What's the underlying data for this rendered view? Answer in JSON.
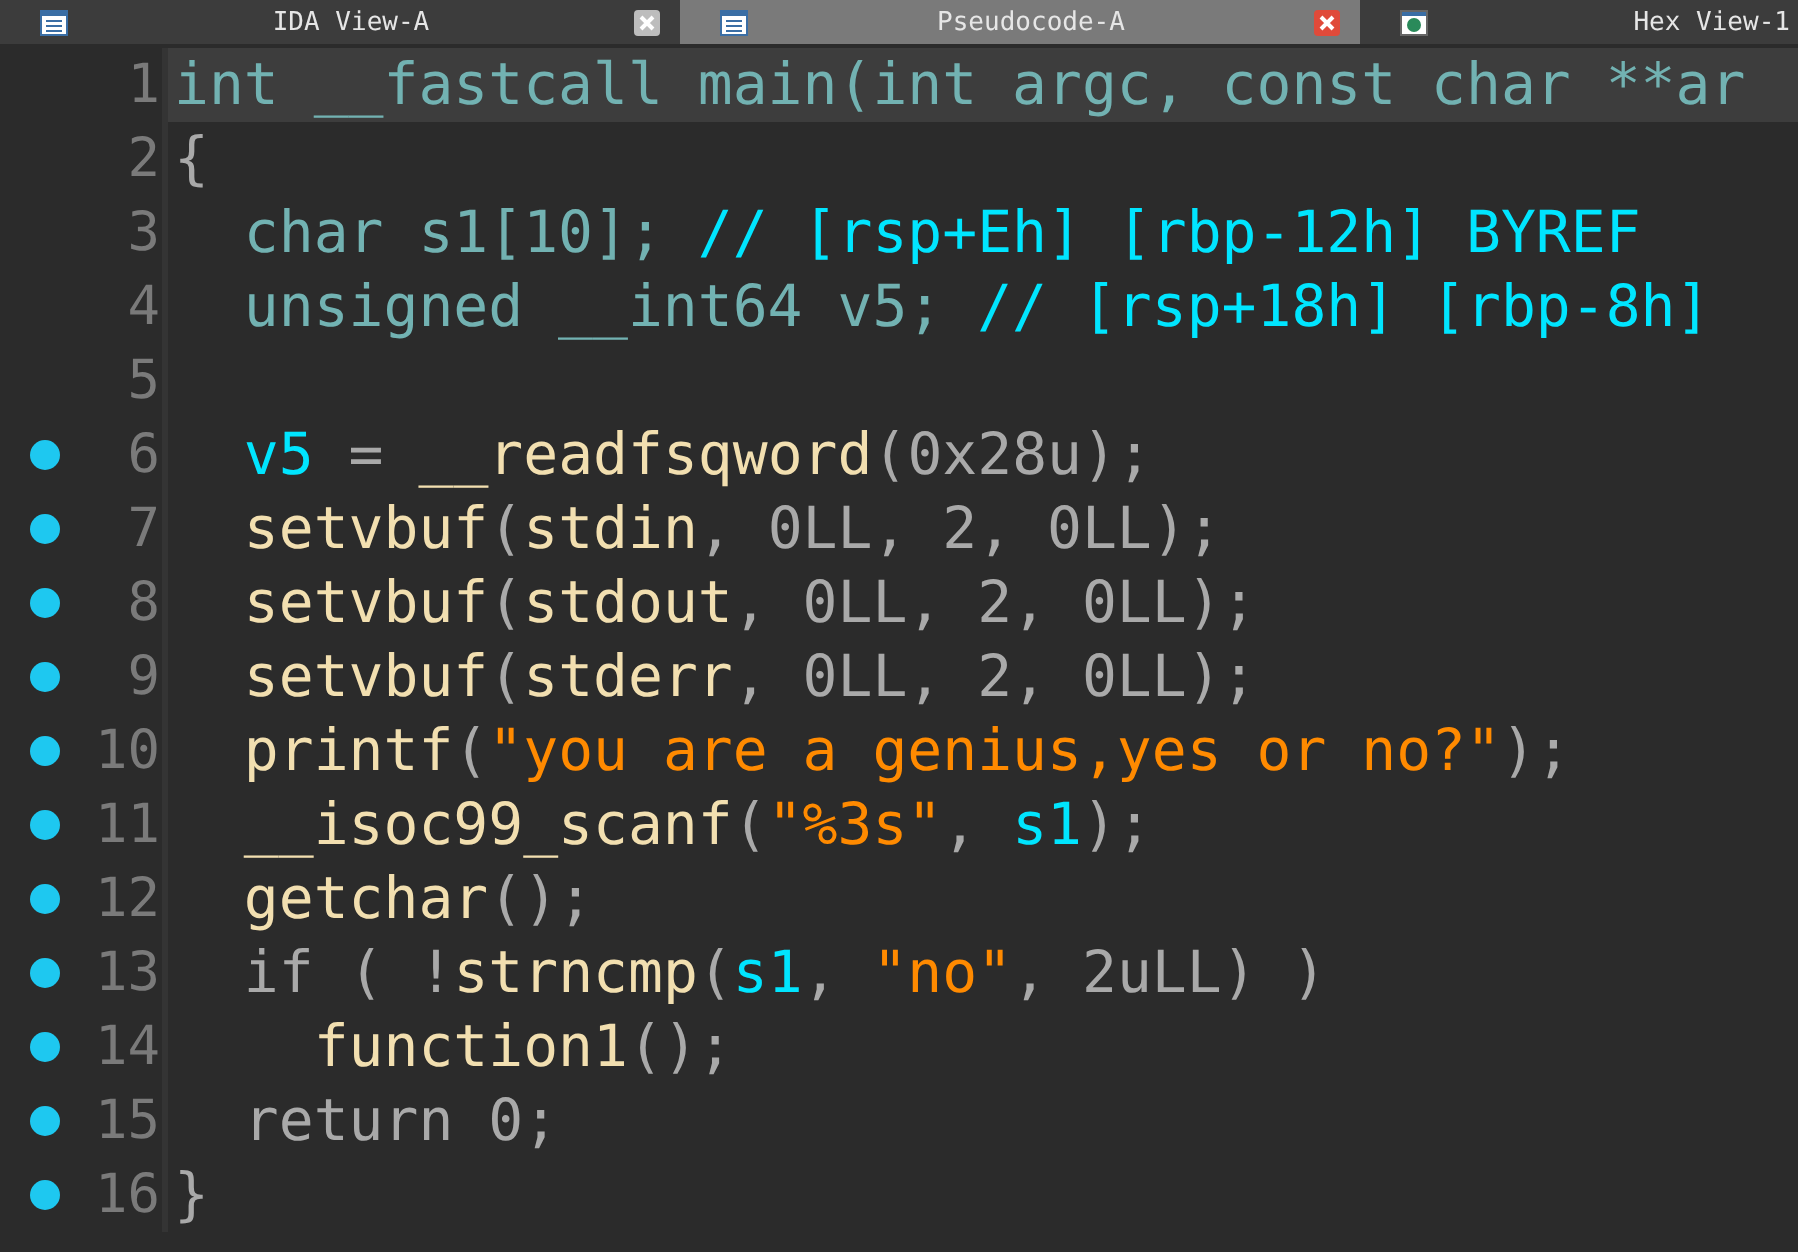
{
  "tabs": [
    {
      "label": "IDA View-A",
      "selected": false,
      "closable": true
    },
    {
      "label": "Pseudocode-A",
      "selected": true,
      "closable": true
    },
    {
      "label": "Hex View-1",
      "selected": false,
      "closable": false
    }
  ],
  "code": {
    "lines": [
      {
        "number": "1",
        "dot": false,
        "current": true,
        "tokens": [
          {
            "text": "int __fastcall main(int argc, const char **ar",
            "kind": "type"
          }
        ]
      },
      {
        "number": "2",
        "dot": false,
        "current": false,
        "tokens": [
          {
            "text": "{",
            "kind": "punct"
          }
        ]
      },
      {
        "number": "3",
        "dot": false,
        "current": false,
        "tokens": [
          {
            "text": "  char s1[10];",
            "kind": "type"
          },
          {
            "text": " // [rsp+Eh] [rbp-12h] BYREF",
            "kind": "comment"
          }
        ]
      },
      {
        "number": "4",
        "dot": false,
        "current": false,
        "tokens": [
          {
            "text": "  unsigned __int64 v5;",
            "kind": "type"
          },
          {
            "text": " // [rsp+18h] [rbp-8h]",
            "kind": "comment"
          }
        ]
      },
      {
        "number": "5",
        "dot": false,
        "current": false
      },
      {
        "number": "6",
        "dot": true,
        "current": false,
        "tokens": [
          {
            "text": "  v5",
            "kind": "var"
          },
          {
            "text": " = ",
            "kind": "punct"
          },
          {
            "text": "__readfsqword",
            "kind": "func"
          },
          {
            "text": "(",
            "kind": "punct"
          },
          {
            "text": "0x28u",
            "kind": "num"
          },
          {
            "text": ");",
            "kind": "punct"
          }
        ]
      },
      {
        "number": "7",
        "dot": true,
        "current": false,
        "tokens": [
          {
            "text": "  setvbuf",
            "kind": "func"
          },
          {
            "text": "(",
            "kind": "punct"
          },
          {
            "text": "stdin",
            "kind": "func"
          },
          {
            "text": ", 0LL, 2, 0LL);",
            "kind": "num"
          }
        ]
      },
      {
        "number": "8",
        "dot": true,
        "current": false,
        "tokens": [
          {
            "text": "  setvbuf",
            "kind": "func"
          },
          {
            "text": "(",
            "kind": "punct"
          },
          {
            "text": "stdout",
            "kind": "func"
          },
          {
            "text": ", 0LL, 2, 0LL);",
            "kind": "num"
          }
        ]
      },
      {
        "number": "9",
        "dot": true,
        "current": false,
        "tokens": [
          {
            "text": "  setvbuf",
            "kind": "func"
          },
          {
            "text": "(",
            "kind": "punct"
          },
          {
            "text": "stderr",
            "kind": "func"
          },
          {
            "text": ", 0LL, 2, 0LL);",
            "kind": "num"
          }
        ]
      },
      {
        "number": "10",
        "dot": true,
        "current": false,
        "tokens": [
          {
            "text": "  printf",
            "kind": "func"
          },
          {
            "text": "(",
            "kind": "punct"
          },
          {
            "text": "\"you are a genius,yes or no?\"",
            "kind": "str"
          },
          {
            "text": ");",
            "kind": "punct"
          }
        ]
      },
      {
        "number": "11",
        "dot": true,
        "current": false,
        "tokens": [
          {
            "text": "  __isoc99_scanf",
            "kind": "func"
          },
          {
            "text": "(",
            "kind": "punct"
          },
          {
            "text": "\"%3s\"",
            "kind": "str"
          },
          {
            "text": ", ",
            "kind": "punct"
          },
          {
            "text": "s1",
            "kind": "var"
          },
          {
            "text": ");",
            "kind": "punct"
          }
        ]
      },
      {
        "number": "12",
        "dot": true,
        "current": false,
        "tokens": [
          {
            "text": "  getchar",
            "kind": "func"
          },
          {
            "text": "();",
            "kind": "punct"
          }
        ]
      },
      {
        "number": "13",
        "dot": true,
        "current": false,
        "tokens": [
          {
            "text": "  if ( !",
            "kind": "punct"
          },
          {
            "text": "strncmp",
            "kind": "func"
          },
          {
            "text": "(",
            "kind": "punct"
          },
          {
            "text": "s1",
            "kind": "var"
          },
          {
            "text": ", ",
            "kind": "punct"
          },
          {
            "text": "\"no\"",
            "kind": "str"
          },
          {
            "text": ", ",
            "kind": "punct"
          },
          {
            "text": "2uLL",
            "kind": "num"
          },
          {
            "text": ") )",
            "kind": "punct"
          }
        ]
      },
      {
        "number": "14",
        "dot": true,
        "current": false,
        "tokens": [
          {
            "text": "    function1",
            "kind": "func"
          },
          {
            "text": "();",
            "kind": "punct"
          }
        ]
      },
      {
        "number": "15",
        "dot": true,
        "current": false,
        "tokens": [
          {
            "text": "  return 0;",
            "kind": "punct"
          }
        ]
      },
      {
        "number": "16",
        "dot": true,
        "current": false,
        "tokens": [
          {
            "text": "}",
            "kind": "punct"
          }
        ]
      }
    ]
  }
}
